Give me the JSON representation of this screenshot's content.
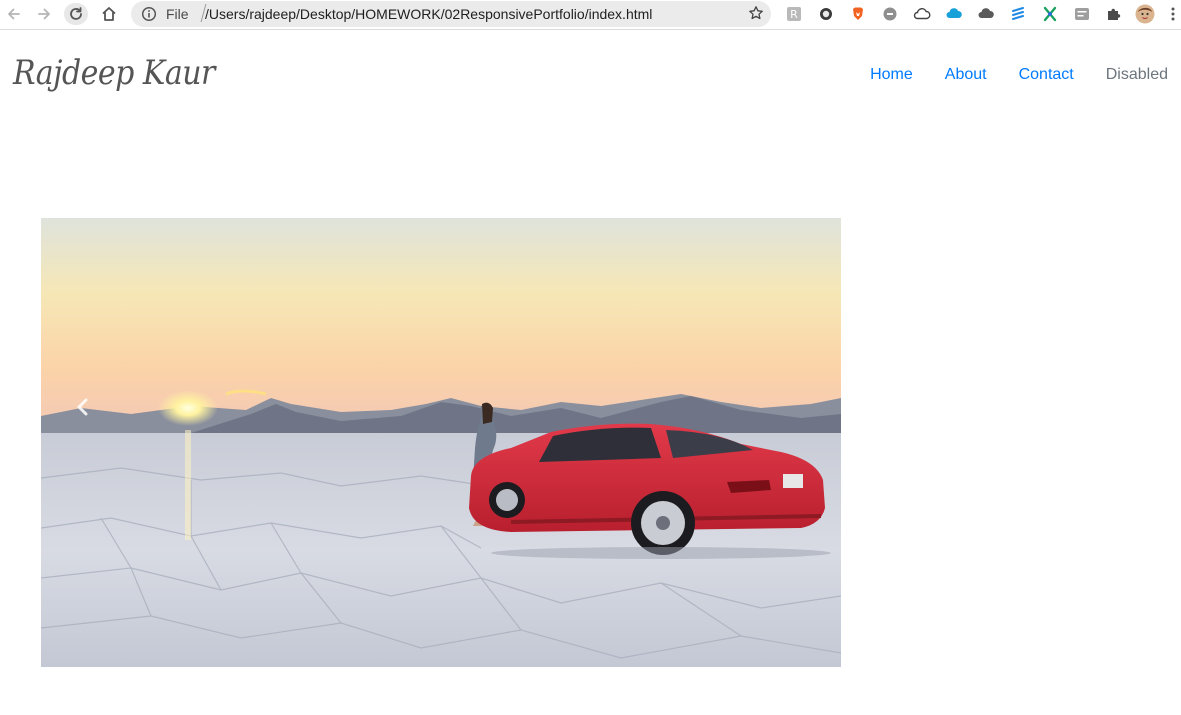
{
  "browser": {
    "scheme_label": "File",
    "url": "/Users/rajdeep/Desktop/HOMEWORK/02ResponsivePortfolio/index.html",
    "buttons": [
      "back-icon",
      "forward-icon",
      "reload-icon",
      "home-icon"
    ],
    "extension_icons": [
      "grammarly-icon",
      "circle-icon",
      "brave-icon",
      "face-icon",
      "cloud-outline-icon",
      "cloud-blue-icon",
      "cloud-dark-icon",
      "stripes-icon",
      "x-shape-icon",
      "badge-icon",
      "puzzle-icon",
      "profile-avatar-icon",
      "menu-dots-icon"
    ]
  },
  "site": {
    "logo_text": "Rajdeep Kaur"
  },
  "nav": {
    "items": [
      {
        "label": "Home"
      },
      {
        "label": "About"
      },
      {
        "label": "Contact"
      },
      {
        "label": "Disabled"
      }
    ]
  },
  "carousel": {
    "prev_icon": "chevron-left-icon"
  },
  "colors": {
    "link": "#007bff",
    "disabled": "#6c757d",
    "logo": "#555555"
  }
}
